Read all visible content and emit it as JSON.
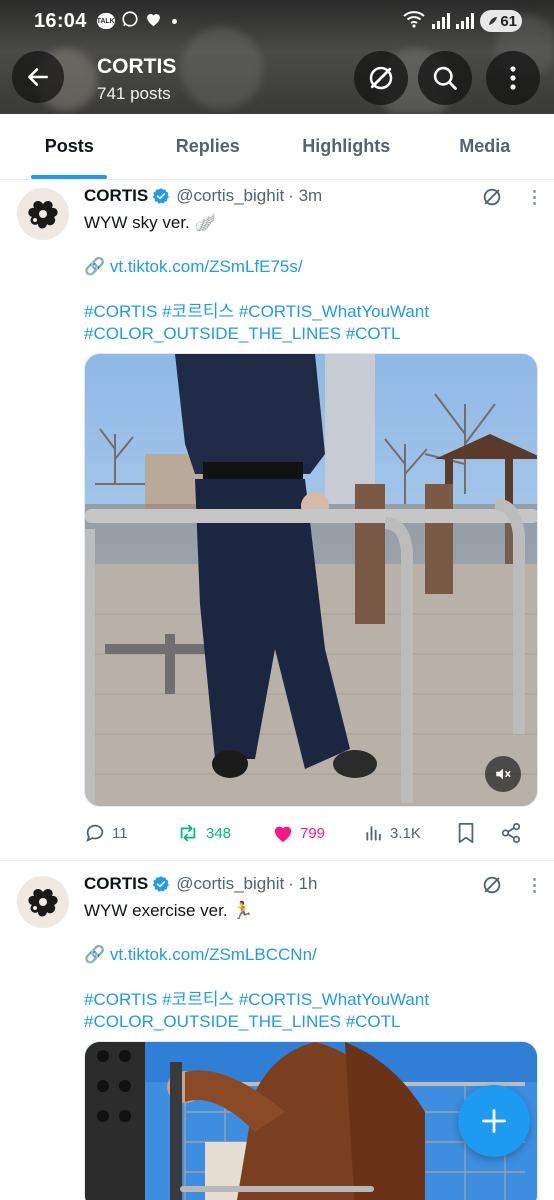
{
  "status_bar": {
    "time": "16:04",
    "talk_label": "TALK",
    "battery": "61"
  },
  "profile": {
    "name": "CORTIS",
    "posts_count": "741 posts"
  },
  "tabs": [
    {
      "label": "Posts",
      "active": true
    },
    {
      "label": "Replies",
      "active": false
    },
    {
      "label": "Highlights",
      "active": false
    },
    {
      "label": "Media",
      "active": false
    }
  ],
  "posts": [
    {
      "name": "CORTIS",
      "handle": "@cortis_bighit",
      "time": "· 3m",
      "text": "WYW sky ver. 🪽",
      "link": "🔗 vt.tiktok.com/ZSmLfE75s/",
      "tags_line1": "#CORTIS #코르티스 #CORTIS_WhatYouWant",
      "tags_line2": "#COLOR_OUTSIDE_THE_LINES #COTL",
      "replies": "11",
      "reposts": "348",
      "likes": "799",
      "views": "3.1K",
      "liked": true
    },
    {
      "name": "CORTIS",
      "handle": "@cortis_bighit",
      "time": "· 1h",
      "text": "WYW exercise ver. 🏃",
      "link": "🔗 vt.tiktok.com/ZSmLBCCNn/",
      "tags_line1": "#CORTIS #코르티스 #CORTIS_WhatYouWant",
      "tags_line2": "#COLOR_OUTSIDE_THE_LINES #COTL"
    }
  ],
  "colors": {
    "accent": "#1d9bf0",
    "repost": "#00ba7c",
    "like": "#f91880",
    "text": "#0f1419",
    "muted": "#536471"
  },
  "icons": [
    "back-arrow-icon",
    "grok-icon",
    "search-icon",
    "more-icon",
    "verified-icon",
    "reply-icon",
    "repost-icon",
    "like-icon",
    "views-icon",
    "bookmark-icon",
    "share-icon",
    "mute-icon",
    "compose-plus-icon"
  ]
}
